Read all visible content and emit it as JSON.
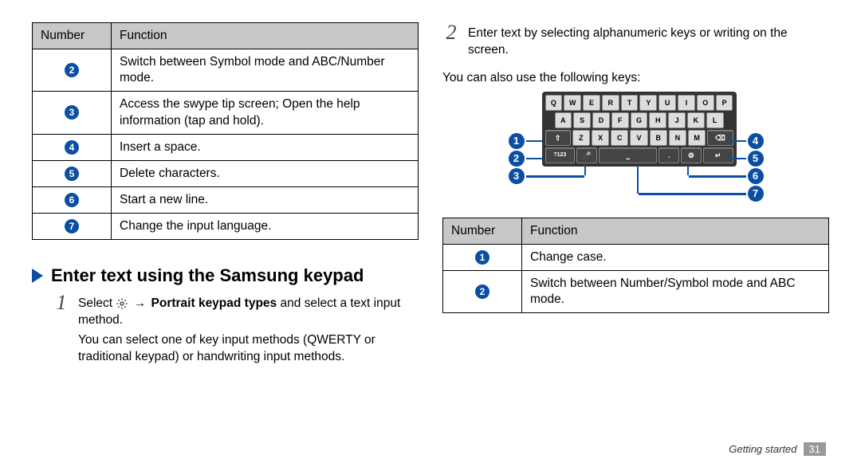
{
  "left_table": {
    "headers": [
      "Number",
      "Function"
    ],
    "rows": [
      {
        "num": "2",
        "text": "Switch between Symbol mode and ABC/Number mode."
      },
      {
        "num": "3",
        "text": "Access the swype tip screen; Open the help information (tap and hold)."
      },
      {
        "num": "4",
        "text": "Insert a space."
      },
      {
        "num": "5",
        "text": "Delete characters."
      },
      {
        "num": "6",
        "text": "Start a new line."
      },
      {
        "num": "7",
        "text": "Change the input language."
      }
    ]
  },
  "heading": "Enter text using the Samsung keypad",
  "step1": {
    "num": "1",
    "pre": "Select ",
    "mid_arrow": "→",
    "bold": " Portrait keypad types",
    "post": " and select a text input method.",
    "second": "You can select one of key input methods (QWERTY or traditional keypad) or handwriting input methods."
  },
  "step2": {
    "num": "2",
    "text": "Enter text by selecting alphanumeric keys or writing on the screen."
  },
  "right_note": "You can also use the following keys:",
  "keyboard_rows": {
    "r1": [
      "Q",
      "W",
      "E",
      "R",
      "T",
      "Y",
      "U",
      "I",
      "O",
      "P"
    ],
    "r2": [
      "A",
      "S",
      "D",
      "F",
      "G",
      "H",
      "J",
      "K",
      "L"
    ],
    "r3_mid": [
      "Z",
      "X",
      "C",
      "V",
      "B",
      "N",
      "M"
    ]
  },
  "right_table": {
    "headers": [
      "Number",
      "Function"
    ],
    "rows": [
      {
        "num": "1",
        "text": "Change case."
      },
      {
        "num": "2",
        "text": "Switch between Number/Symbol mode and ABC mode."
      }
    ]
  },
  "footer": {
    "label": "Getting started",
    "page": "31"
  },
  "callouts": {
    "l1": "1",
    "l2": "2",
    "l3": "3",
    "r4": "4",
    "r5": "5",
    "r6": "6",
    "r7": "7"
  }
}
